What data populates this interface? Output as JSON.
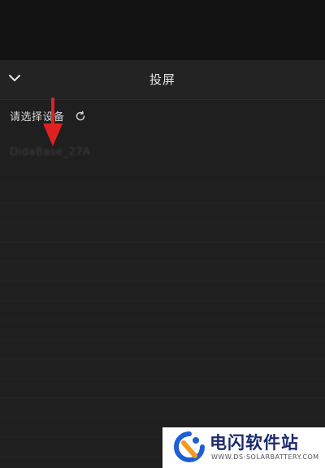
{
  "header": {
    "title": "投屏",
    "collapse_icon": "chevron-down-icon"
  },
  "device_select": {
    "label": "请选择设备",
    "refresh_icon": "refresh-icon"
  },
  "devices": [
    {
      "name": "DidaBase_27A"
    }
  ],
  "annotation": {
    "arrow_color": "#e0211f",
    "arrow_icon": "arrow-down-icon"
  },
  "watermark": {
    "name": "电闪软件站",
    "url": "WWW.DS-SOLARBATTERY.COM",
    "logo_icon": "ds-logo-icon"
  },
  "colors": {
    "background": "#1f1f1f",
    "header_bg": "#232323",
    "top_bar": "#131313",
    "text_primary": "#e6e6e6",
    "accent_red": "#e0211f",
    "logo_blue": "#1d5fd6",
    "logo_orange": "#f39a1e"
  }
}
